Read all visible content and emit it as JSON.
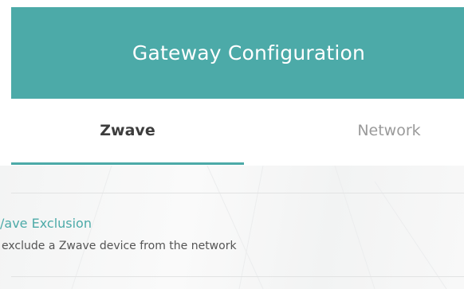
{
  "header": {
    "title": "Gateway Configuration"
  },
  "tabs": [
    {
      "label": "Zwave",
      "active": true
    },
    {
      "label": "Network",
      "active": false
    }
  ],
  "list": {
    "items": [
      {
        "title": "/ave Exclusion",
        "description": "exclude a Zwave device from the network"
      }
    ]
  },
  "colors": {
    "accent": "#4caaa8",
    "header_text": "#ffffff",
    "active_tab_text": "#3d3d3d",
    "inactive_tab_text": "#9a9a9a",
    "description_text": "#555555"
  }
}
